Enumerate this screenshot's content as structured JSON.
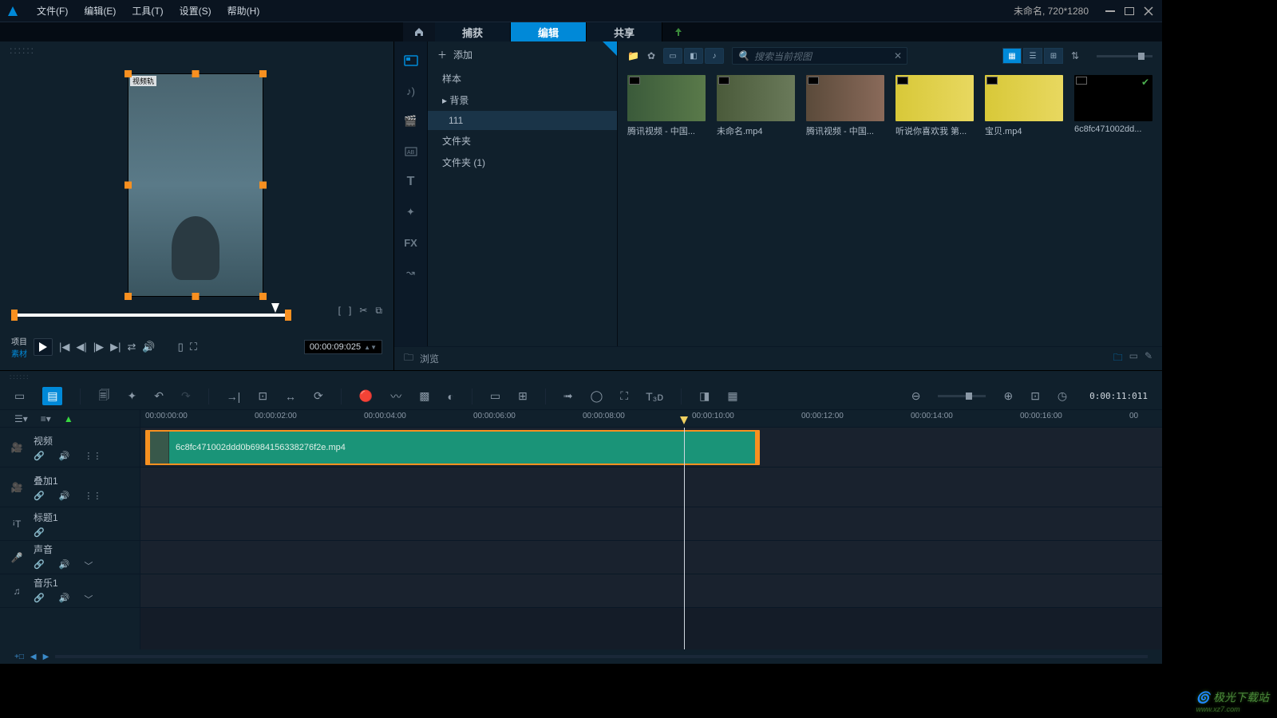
{
  "menubar": {
    "file": "文件(F)",
    "edit": "编辑(E)",
    "tools": "工具(T)",
    "settings": "设置(S)",
    "help": "帮助(H)"
  },
  "project_info": "未命名, 720*1280",
  "tabs": {
    "capture": "捕获",
    "edit": "编辑",
    "share": "共享"
  },
  "preview": {
    "track_label": "视频轨",
    "proj_label": "项目",
    "source_label": "素材",
    "timecode": "00:00:09:025"
  },
  "library": {
    "add_label": "添加",
    "tree": [
      "样本",
      "背景",
      "111",
      "文件夹",
      "文件夹 (1)"
    ],
    "search_placeholder": "搜索当前视图",
    "items": [
      {
        "label": "腾讯视频 - 中国..."
      },
      {
        "label": "未命名.mp4"
      },
      {
        "label": "腾讯视频 - 中国..."
      },
      {
        "label": "听说你喜欢我 第..."
      },
      {
        "label": "宝贝.mp4"
      },
      {
        "label": "6c8fc471002dd..."
      }
    ],
    "browse_label": "浏览"
  },
  "timeline": {
    "timecode": "0:00:11:011",
    "ruler": [
      "00:00:00:00",
      "00:00:02:00",
      "00:00:04:00",
      "00:00:06:00",
      "00:00:08:00",
      "00:00:10:00",
      "00:00:12:00",
      "00:00:14:00",
      "00:00:16:00",
      "00"
    ],
    "tracks": [
      {
        "name": "视频",
        "icon": "video",
        "size": "lg",
        "ctrls": [
          "link",
          "vol",
          "fx"
        ]
      },
      {
        "name": "叠加1",
        "icon": "video",
        "size": "lg",
        "ctrls": [
          "link",
          "vol",
          "fx"
        ]
      },
      {
        "name": "标题1",
        "icon": "title",
        "size": "sm",
        "ctrls": [
          "link"
        ]
      },
      {
        "name": "声音",
        "icon": "mic",
        "size": "sm",
        "ctrls": [
          "link",
          "vol",
          "more"
        ]
      },
      {
        "name": "音乐1",
        "icon": "music",
        "size": "sm",
        "ctrls": [
          "link",
          "vol",
          "more"
        ]
      }
    ],
    "clip_label": "6c8fc471002ddd0b6984156338276f2e.mp4"
  },
  "watermark": "极光下载站"
}
